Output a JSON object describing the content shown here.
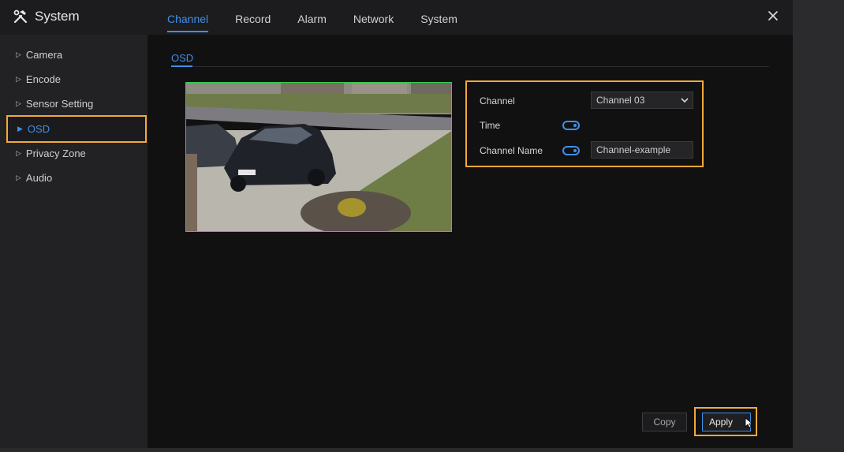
{
  "app": {
    "title": "System"
  },
  "top_tabs": [
    {
      "label": "Channel",
      "active": true
    },
    {
      "label": "Record",
      "active": false
    },
    {
      "label": "Alarm",
      "active": false
    },
    {
      "label": "Network",
      "active": false
    },
    {
      "label": "System",
      "active": false
    }
  ],
  "sidebar": {
    "items": [
      {
        "label": "Camera",
        "active": false
      },
      {
        "label": "Encode",
        "active": false
      },
      {
        "label": "Sensor Setting",
        "active": false
      },
      {
        "label": "OSD",
        "active": true
      },
      {
        "label": "Privacy Zone",
        "active": false
      },
      {
        "label": "Audio",
        "active": false
      }
    ]
  },
  "subtab": {
    "label": "OSD"
  },
  "osd": {
    "channel_label": "Channel",
    "channel_value": "Channel 03",
    "time_label": "Time",
    "time_enabled": true,
    "channel_name_label": "Channel Name",
    "channel_name_enabled": true,
    "channel_name_value": "Channel-example"
  },
  "buttons": {
    "copy": "Copy",
    "apply": "Apply"
  },
  "colors": {
    "accent": "#3f8fe8",
    "highlight": "#f3a93a",
    "preview_border": "#2fd34a"
  },
  "icons": [
    "hammer-wrench-icon",
    "close-icon",
    "triangle-right-icon",
    "chevron-down-icon",
    "toggle-icon",
    "mouse-cursor-icon"
  ]
}
